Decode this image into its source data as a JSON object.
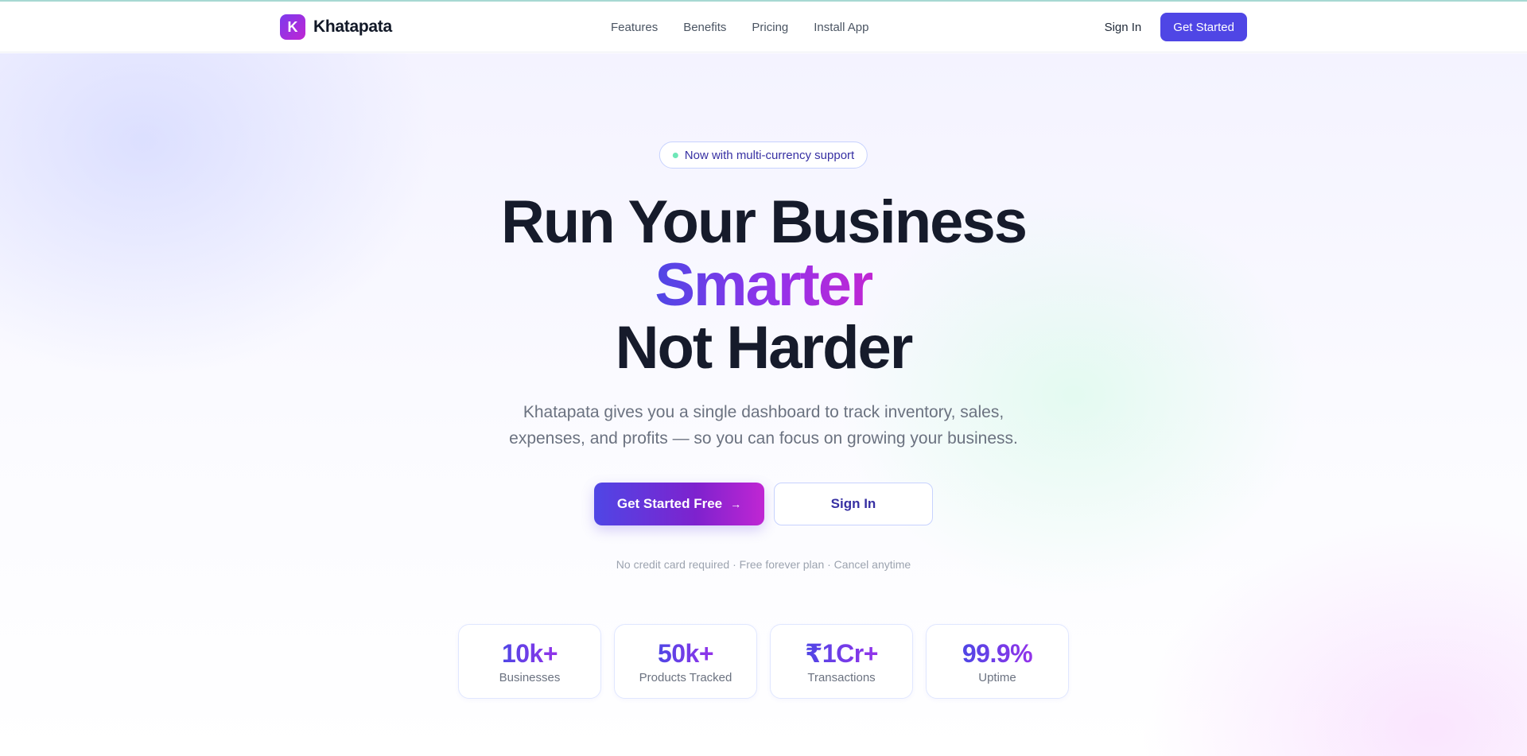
{
  "colors": {
    "accent": "#4f46e5",
    "gradient_start": "#4f46e5",
    "gradient_end": "#c026d3",
    "badge_dot": "#6ee7b7"
  },
  "nav": {
    "logo_letter": "K",
    "brand": "Khatapata",
    "links": [
      "Features",
      "Benefits",
      "Pricing",
      "Install App"
    ],
    "sign_in": "Sign In",
    "get_started": "Get Started"
  },
  "hero": {
    "badge": "Now with multi-currency support",
    "headline_line1": "Run Your Business",
    "headline_line2": "Smarter",
    "headline_line3": "Not Harder",
    "subtitle": "Khatapata gives you a single dashboard to track inventory, sales, expenses, and profits — so you can focus on growing your business.",
    "cta_primary": "Get Started Free",
    "cta_primary_icon": "arrow-right-icon",
    "cta_secondary": "Sign In",
    "fineprint": "No credit card required · Free forever plan · Cancel anytime"
  },
  "stats": [
    {
      "value": "10k+",
      "label": "Businesses"
    },
    {
      "value": "50k+",
      "label": "Products Tracked"
    },
    {
      "value": "₹1Cr+",
      "label": "Transactions"
    },
    {
      "value": "99.9%",
      "label": "Uptime"
    }
  ]
}
